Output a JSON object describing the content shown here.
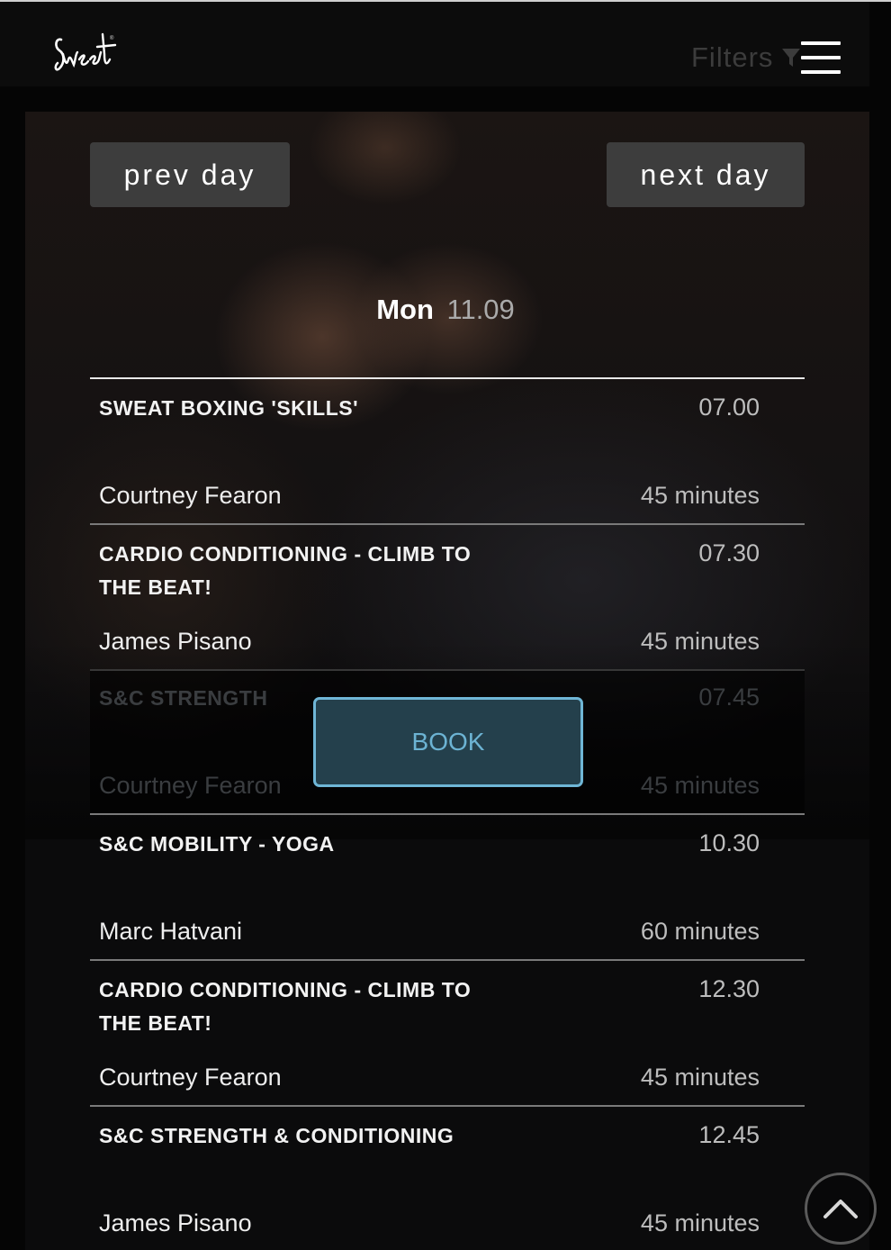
{
  "brand": {
    "logo_name": "Sweat"
  },
  "header": {
    "filters_label": "Filters"
  },
  "nav": {
    "prev_label": "prev day",
    "next_label": "next day"
  },
  "date": {
    "weekday": "Mon",
    "day_month": "11.09"
  },
  "classes": [
    {
      "title": "SWEAT BOXING 'SKILLS'",
      "time": "07.00",
      "instructor": "Courtney Fearon",
      "duration": "45 minutes"
    },
    {
      "title": "CARDIO CONDITIONING - CLIMB TO THE BEAT!",
      "time": "07.30",
      "instructor": "James Pisano",
      "duration": "45 minutes"
    },
    {
      "title": "S&C STRENGTH",
      "time": "07.45",
      "instructor": "Courtney Fearon",
      "duration": "45 minutes",
      "selected": true
    },
    {
      "title": "S&C MOBILITY - YOGA",
      "time": "10.30",
      "instructor": "Marc Hatvani",
      "duration": "60 minutes"
    },
    {
      "title": "CARDIO CONDITIONING - CLIMB TO THE BEAT!",
      "time": "12.30",
      "instructor": "Courtney Fearon",
      "duration": "45 minutes"
    },
    {
      "title": "S&C STRENGTH & CONDITIONING",
      "time": "12.45",
      "instructor": "James Pisano",
      "duration": "45 minutes"
    }
  ],
  "book": {
    "label": "BOOK"
  },
  "colors": {
    "accent": "#6fb6d6",
    "book_bg": "#24404c",
    "button_bg": "#3d3d3d"
  },
  "icons": {
    "filter": "funnel-icon",
    "menu": "hamburger-icon",
    "scroll_top": "chevron-up-icon"
  }
}
